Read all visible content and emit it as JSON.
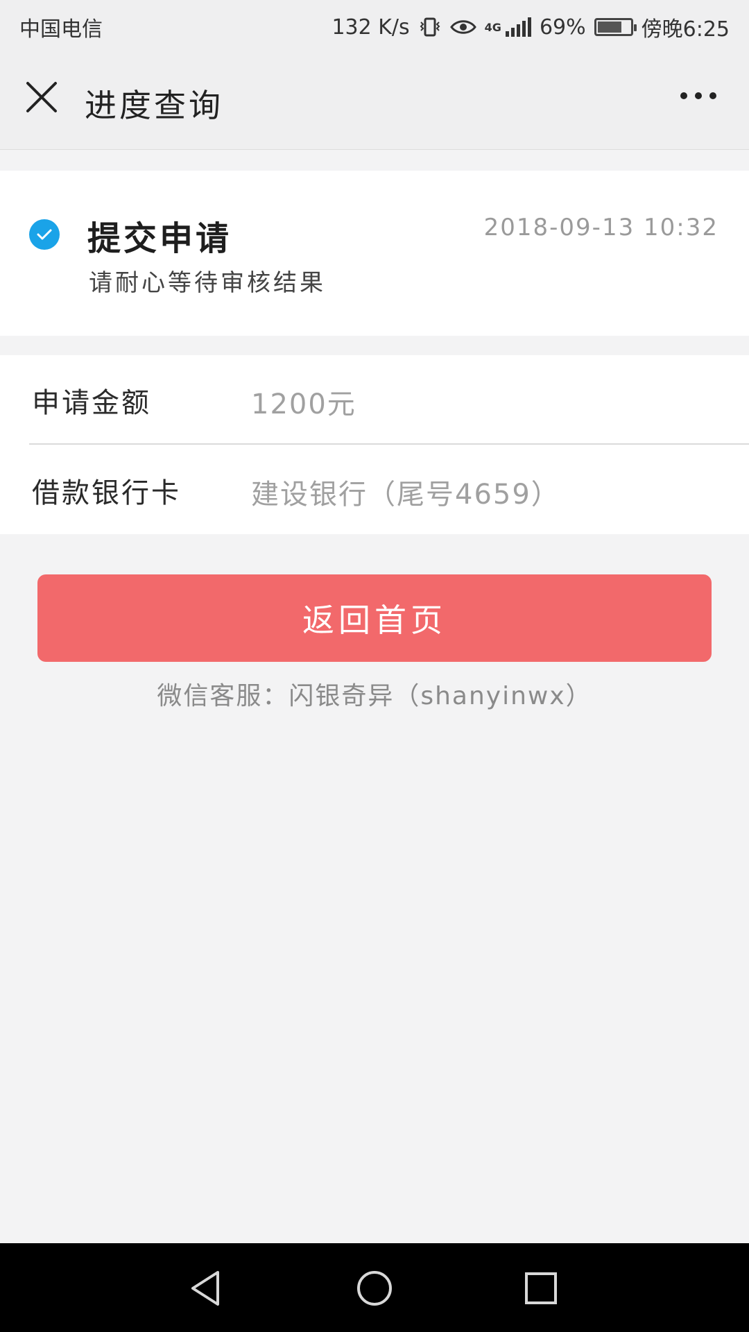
{
  "status_bar": {
    "carrier": "中国电信",
    "speed": "132 K/s",
    "network": "4G",
    "battery": "69%",
    "battery_level": 0.69,
    "time": "傍晚6:25",
    "icons": [
      "vibrate-icon",
      "eye-icon",
      "signal-icon",
      "battery-icon"
    ]
  },
  "header": {
    "title": "进度查询",
    "icons": [
      "close-icon",
      "more-icon"
    ]
  },
  "progress": {
    "step_title": "提交申请",
    "step_time": "2018-09-13 10:32",
    "step_desc": "请耐心等待审核结果",
    "icon": "check-circle-icon",
    "accent_color": "#1aa3e8"
  },
  "details": {
    "rows": [
      {
        "label": "申请金额",
        "value": "1200元"
      },
      {
        "label": "借款银行卡",
        "value": "建设银行（尾号4659）"
      }
    ]
  },
  "actions": {
    "home_button": "返回首页",
    "button_color": "#f2696b"
  },
  "footer": {
    "service": "微信客服：闪银奇异（shanyinwx）"
  },
  "nav": {
    "icons": [
      "back-icon",
      "home-icon",
      "recent-apps-icon"
    ]
  }
}
